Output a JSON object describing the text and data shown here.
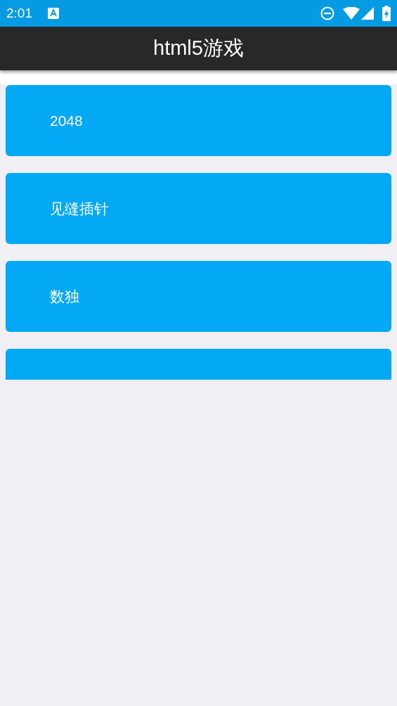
{
  "status_bar": {
    "time": "2:01"
  },
  "app_bar": {
    "title": "html5游戏"
  },
  "games": [
    {
      "kind": "labeled",
      "label": "2048"
    },
    {
      "kind": "labeled",
      "label": "见缝插针"
    },
    {
      "kind": "labeled",
      "label": "数独"
    },
    {
      "kind": "clipped"
    }
  ]
}
